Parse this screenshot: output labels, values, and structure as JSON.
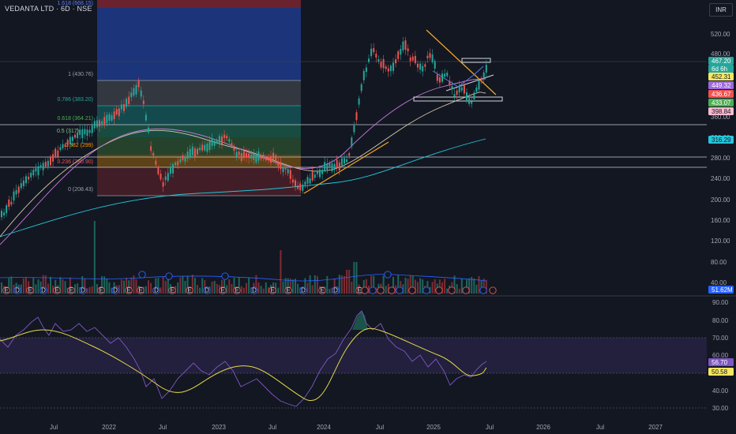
{
  "header": {
    "symbol_title": "VEDANTA LTD · 6D · NSE",
    "currency": "INR"
  },
  "colors": {
    "background": "#131722",
    "up": "#26a69a",
    "down": "#ef5350",
    "fib_top_blue": "#1e3a8a",
    "rsi_line": "#7e57c2",
    "rsi_ma": "#e6d84a",
    "trend_orange": "#f5a623"
  },
  "price_axis": {
    "ticks": [
      "520.00",
      "480.00",
      "440.00",
      "400.00",
      "360.00",
      "320.00",
      "280.00",
      "240.00",
      "200.00",
      "160.00",
      "120.00",
      "80.00",
      "40.00"
    ]
  },
  "price_tags": [
    {
      "label": "467.20",
      "bg": "#26a69a",
      "fg": "#ffffff"
    },
    {
      "label": "6d 6h",
      "bg": "#26a69a",
      "fg": "#ffffff"
    },
    {
      "label": "452.31",
      "bg": "#f5e663",
      "fg": "#131722"
    },
    {
      "label": "449.32",
      "bg": "#9c6ade",
      "fg": "#ffffff"
    },
    {
      "label": "436.67",
      "bg": "#ef5350",
      "fg": "#ffffff"
    },
    {
      "label": "433.07",
      "bg": "#4caf50",
      "fg": "#ffffff"
    },
    {
      "label": "398.84",
      "bg": "#f8bbd0",
      "fg": "#131722"
    },
    {
      "label": "316.29",
      "bg": "#26c6da",
      "fg": "#131722"
    },
    {
      "label": "51.62M",
      "bg": "#2962ff",
      "fg": "#ffffff"
    }
  ],
  "fib_labels": [
    "1.618 (668.15)",
    "1 (430.76)",
    "0.786 (383.20)",
    "0.618 (364.21)",
    "0.5 (317)",
    "0.382 (299)",
    "0.236 (280.90)",
    "0 (208.43)"
  ],
  "rsi_axis": {
    "ticks": [
      "90.00",
      "80.00",
      "70.00",
      "60.00",
      "50.00",
      "40.00",
      "30.00"
    ]
  },
  "rsi_tags": [
    {
      "label": "56.70",
      "bg": "#7e57c2",
      "fg": "#ffffff"
    },
    {
      "label": "50.58",
      "bg": "#f5e663",
      "fg": "#131722"
    }
  ],
  "time_axis": {
    "ticks": [
      "Jul",
      "2022",
      "Jul",
      "2023",
      "Jul",
      "2024",
      "Jul",
      "2025",
      "Jul",
      "2026",
      "Jul",
      "2027"
    ]
  },
  "event_markers": [
    "E",
    "D",
    "E",
    "D",
    "E",
    "E",
    "D",
    "E",
    "D",
    "E",
    "E",
    "D",
    "E",
    "E",
    "D",
    "E",
    "E",
    "D",
    "E",
    "E",
    "D",
    "E",
    "D",
    "E"
  ]
}
